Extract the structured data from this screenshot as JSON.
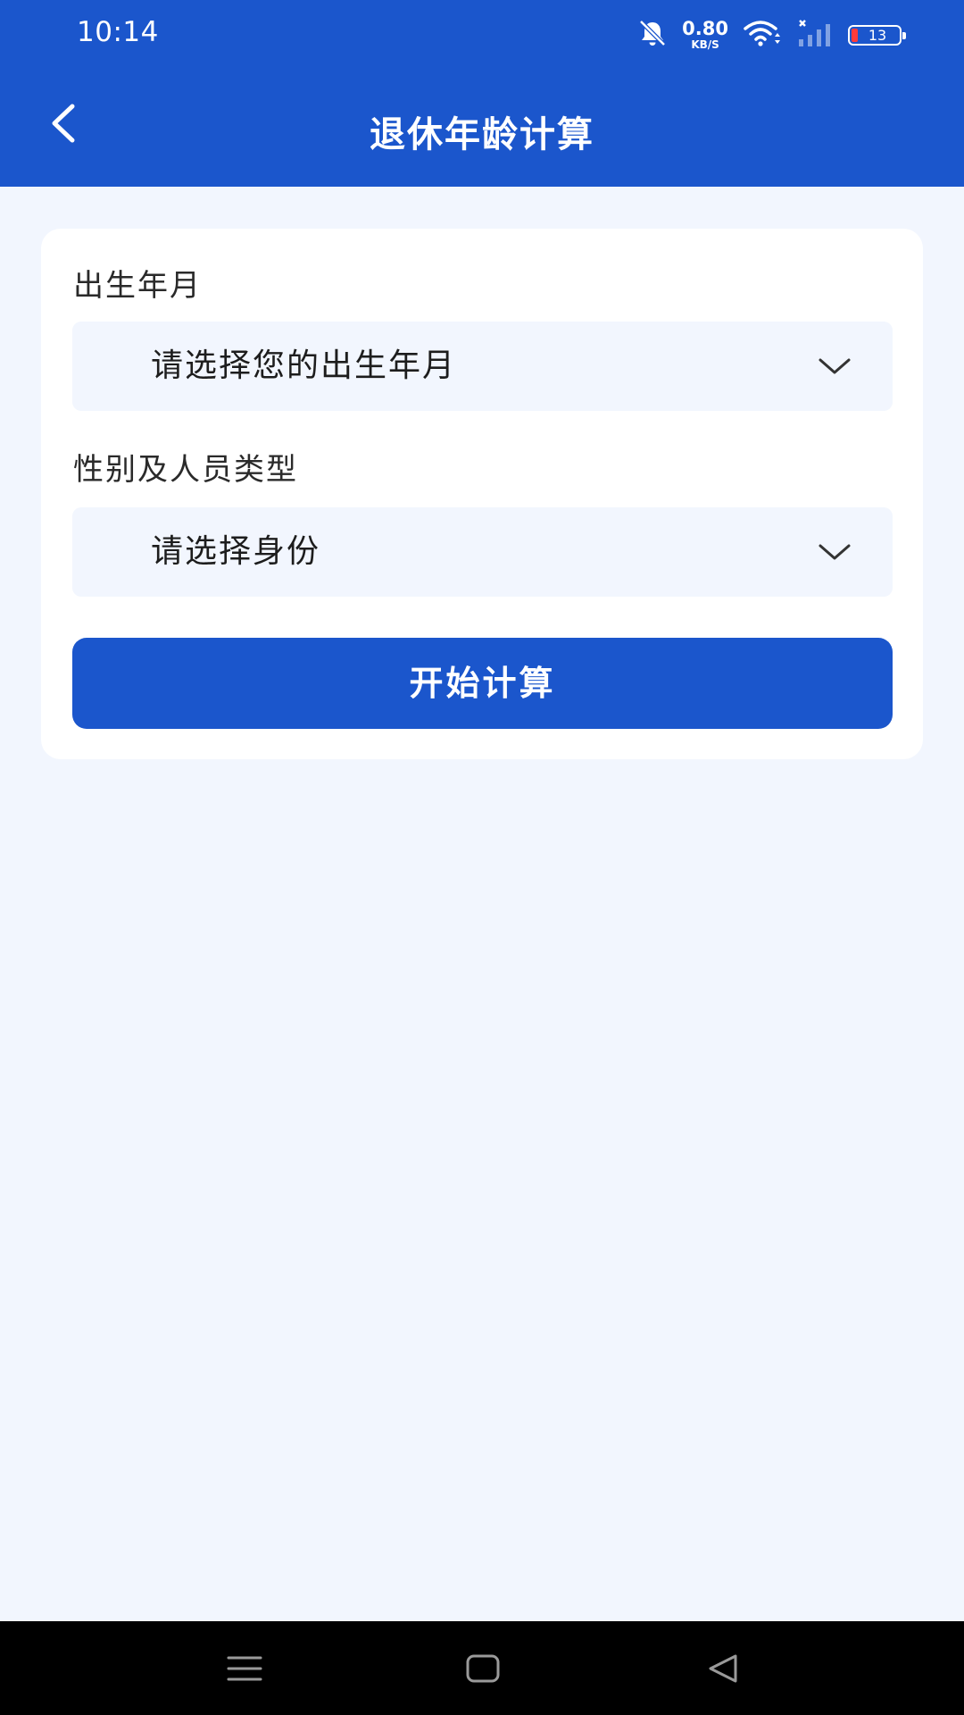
{
  "status_bar": {
    "time": "10:14",
    "net_speed_value": "0.80",
    "net_speed_unit": "KB/S",
    "battery_level": "13",
    "icons": [
      "bell-muted-icon",
      "wifi-icon",
      "signal-icon",
      "battery-icon"
    ]
  },
  "header": {
    "title": "退休年龄计算",
    "back_icon": "chevron-left-icon"
  },
  "form": {
    "birth": {
      "label": "出生年月",
      "placeholder": "请选择您的出生年月"
    },
    "identity": {
      "label": "性别及人员类型",
      "placeholder": "请选择身份"
    },
    "submit_label": "开始计算"
  },
  "system_nav": {
    "buttons": [
      "menu-icon",
      "home-icon",
      "back-triangle-icon"
    ]
  },
  "colors": {
    "primary": "#1b56cc",
    "page_background": "#f2f6fe",
    "card_background": "#ffffff",
    "select_background": "#f2f6fe",
    "battery_low": "#ff3b3b"
  }
}
